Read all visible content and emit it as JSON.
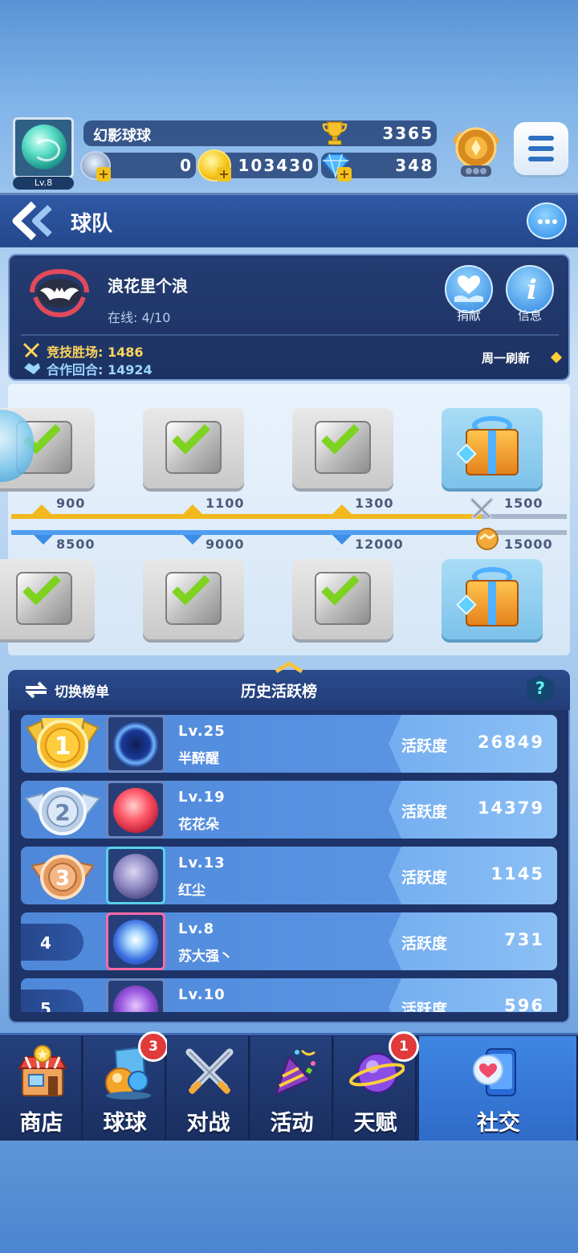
{
  "player": {
    "level": "Lv.8",
    "name": "幻影球球",
    "trophies": "3365",
    "silver": "0",
    "gold": "103430",
    "diamonds": "348"
  },
  "header": {
    "title": "球队"
  },
  "team": {
    "name": "浪花里个浪",
    "online": "在线: 4/10",
    "donate_label": "捐献",
    "info_label": "信息",
    "arena_wins": "竞技胜场: 1486",
    "coop_rounds": "合作回合: 14924",
    "refresh_note": "周一刷新"
  },
  "rewards": {
    "gold_milestones": [
      "900",
      "1100",
      "1300",
      "1500"
    ],
    "blue_milestones": [
      "8500",
      "9000",
      "12000",
      "15000"
    ]
  },
  "ranking": {
    "switch_label": "切换榜单",
    "title": "历史活跃榜",
    "help_label": "?",
    "activity_label": "活跃度",
    "rows": [
      {
        "rank": "1",
        "level": "Lv.25",
        "name": "半醉醒",
        "activity": "26849"
      },
      {
        "rank": "2",
        "level": "Lv.19",
        "name": "花花朵",
        "activity": "14379"
      },
      {
        "rank": "3",
        "level": "Lv.13",
        "name": "红尘",
        "activity": "1145"
      },
      {
        "rank": "4",
        "level": "Lv.8",
        "name": "苏大强丶",
        "activity": "731"
      },
      {
        "rank": "5",
        "level": "Lv.10",
        "name": "",
        "activity": "596"
      }
    ]
  },
  "nav": {
    "items": [
      {
        "label": "商店",
        "badge": ""
      },
      {
        "label": "球球",
        "badge": "3"
      },
      {
        "label": "对战",
        "badge": ""
      },
      {
        "label": "活动",
        "badge": ""
      },
      {
        "label": "天赋",
        "badge": "1"
      },
      {
        "label": "社交",
        "badge": ""
      }
    ]
  }
}
